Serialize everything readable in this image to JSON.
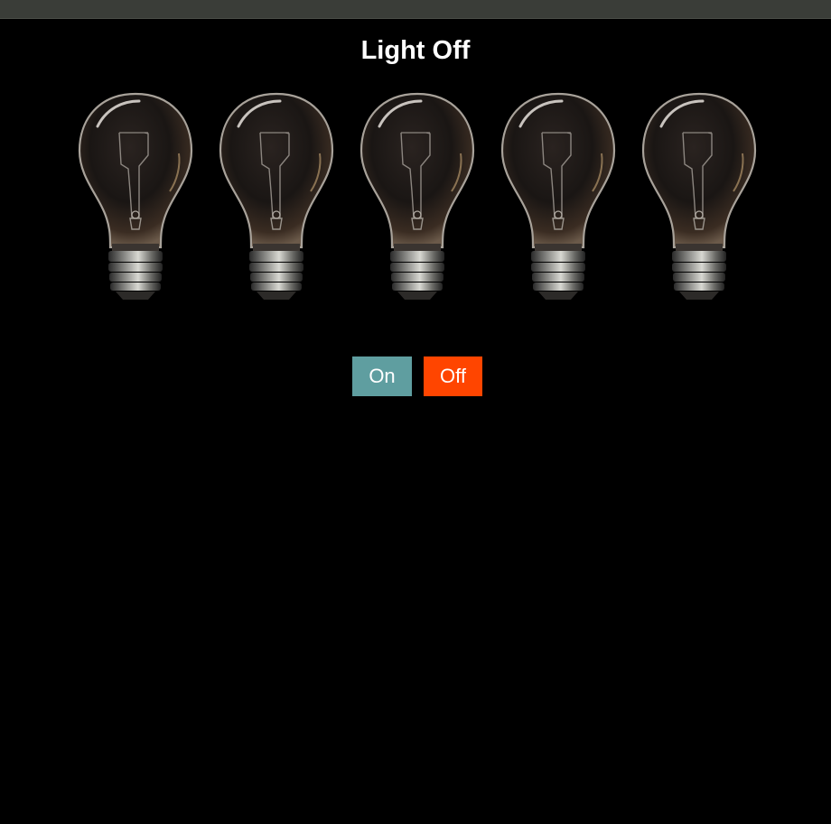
{
  "page": {
    "title": "Light Off"
  },
  "bulbs": {
    "count": 5,
    "state": "off"
  },
  "controls": {
    "on_label": "On",
    "off_label": "Off"
  },
  "colors": {
    "background": "#000000",
    "topbar": "#3a3d38",
    "on_button": "#5f9ea0",
    "off_button": "#ff4500",
    "title": "#ffffff"
  }
}
